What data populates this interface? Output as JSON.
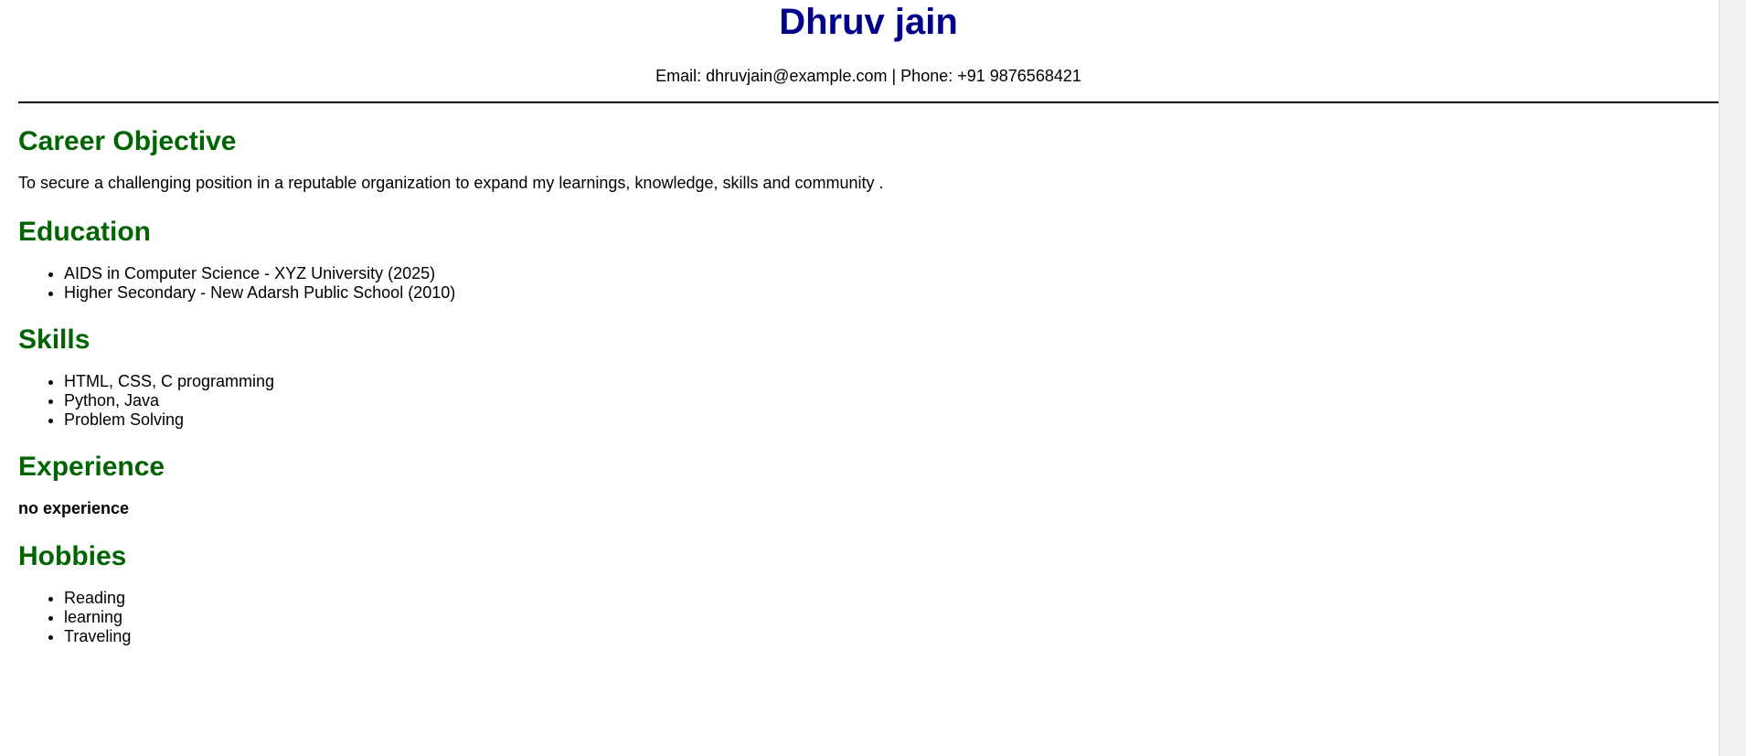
{
  "header": {
    "name": "Dhruv jain",
    "contact": "Email: dhruvjain@example.com | Phone: +91 9876568421"
  },
  "career_objective": {
    "title": "Career Objective",
    "text": "To secure a challenging position in a reputable organization to expand my learnings, knowledge, skills and community ."
  },
  "education": {
    "title": "Education",
    "items": [
      "AIDS in Computer Science - XYZ University (2025)",
      "Higher Secondary - New Adarsh Public School (2010)"
    ]
  },
  "skills": {
    "title": "Skills",
    "items": [
      "HTML, CSS, C programming",
      "Python, Java",
      "Problem Solving"
    ]
  },
  "experience": {
    "title": "Experience",
    "text": "no experience"
  },
  "hobbies": {
    "title": "Hobbies",
    "items": [
      "Reading",
      "learning",
      "Traveling"
    ]
  },
  "colors": {
    "name": "#00008b",
    "section_heading": "#006400"
  }
}
